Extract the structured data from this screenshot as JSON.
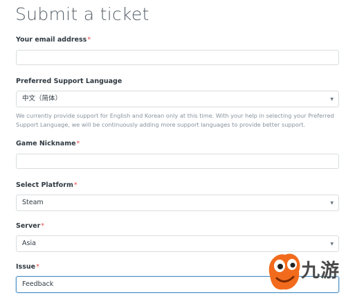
{
  "page": {
    "title": "Submit a ticket"
  },
  "form": {
    "required_marker": "*",
    "email": {
      "label": "Your email address",
      "value": ""
    },
    "language": {
      "label": "Preferred Support Language",
      "value": "中文（简体）",
      "hint": "We currently provide support for English and Korean only at this time. With your help in selecting your Preferred Support Language, we will be continuously adding more support languages to provide better support."
    },
    "nickname": {
      "label": "Game Nickname",
      "value": ""
    },
    "platform": {
      "label": "Select Platform",
      "value": "Steam"
    },
    "server": {
      "label": "Server",
      "value": "Asia"
    },
    "issue": {
      "label": "Issue",
      "value": "Feedback"
    }
  },
  "icons": {
    "dropdown": "chevron-down-icon"
  },
  "watermark": {
    "text": "九游",
    "mascot": "mascot-logo"
  },
  "colors": {
    "required": "#e84c4c",
    "focus_border": "#5293c7",
    "mascot_orange": "#f26b1d"
  }
}
